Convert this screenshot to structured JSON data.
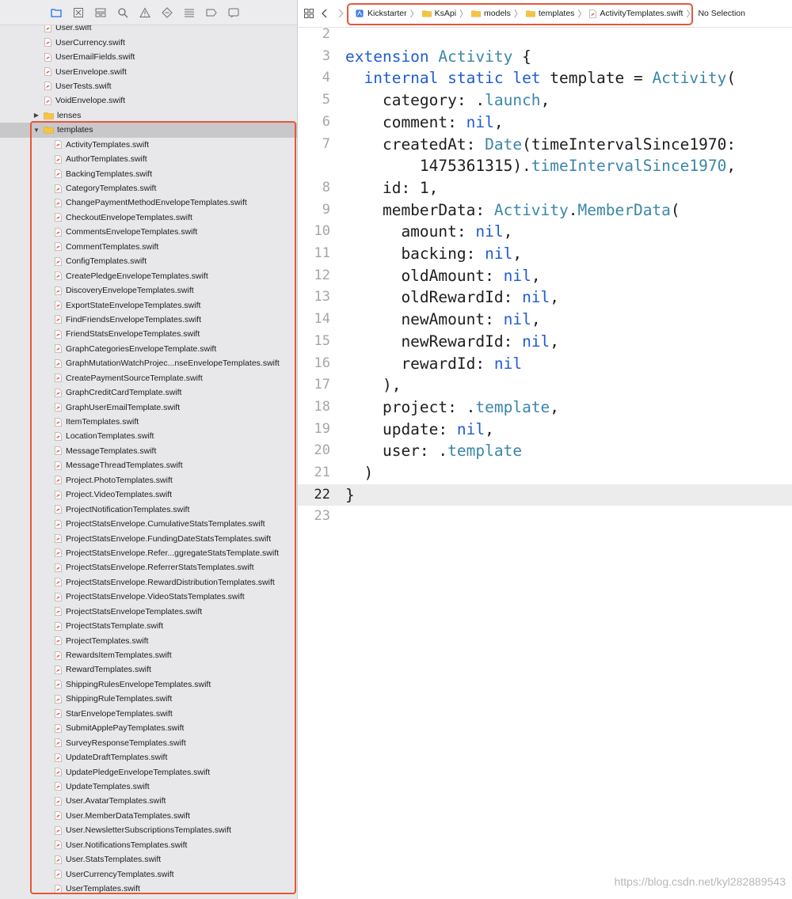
{
  "sidebar": {
    "navigator_icons": [
      "folder-icon",
      "source-control-icon",
      "symbol-icon",
      "find-icon",
      "issue-icon",
      "test-icon",
      "debug-icon",
      "breakpoint-icon",
      "report-icon"
    ],
    "files_before": [
      "User.swift",
      "UserCurrency.swift",
      "UserEmailFields.swift",
      "UserEnvelope.swift",
      "UserTests.swift",
      "VoidEnvelope.swift"
    ],
    "lenses_folder": "lenses",
    "templates_folder": "templates",
    "template_files": [
      "ActivityTemplates.swift",
      "AuthorTemplates.swift",
      "BackingTemplates.swift",
      "CategoryTemplates.swift",
      "ChangePaymentMethodEnvelopeTemplates.swift",
      "CheckoutEnvelopeTemplates.swift",
      "CommentsEnvelopeTemplates.swift",
      "CommentTemplates.swift",
      "ConfigTemplates.swift",
      "CreatePledgeEnvelopeTemplates.swift",
      "DiscoveryEnvelopeTemplates.swift",
      "ExportStateEnvelopeTemplates.swift",
      "FindFriendsEnvelopeTemplates.swift",
      "FriendStatsEnvelopeTemplates.swift",
      "GraphCategoriesEnvelopeTemplate.swift",
      "GraphMutationWatchProjec...nseEnvelopeTemplates.swift",
      "CreatePaymentSourceTemplate.swift",
      "GraphCreditCardTemplate.swift",
      "GraphUserEmailTemplate.swift",
      "ItemTemplates.swift",
      "LocationTemplates.swift",
      "MessageTemplates.swift",
      "MessageThreadTemplates.swift",
      "Project.PhotoTemplates.swift",
      "Project.VideoTemplates.swift",
      "ProjectNotificationTemplates.swift",
      "ProjectStatsEnvelope.CumulativeStatsTemplates.swift",
      "ProjectStatsEnvelope.FundingDateStatsTemplates.swift",
      "ProjectStatsEnvelope.Refer...ggregateStatsTemplate.swift",
      "ProjectStatsEnvelope.ReferrerStatsTemplates.swift",
      "ProjectStatsEnvelope.RewardDistributionTemplates.swift",
      "ProjectStatsEnvelope.VideoStatsTemplates.swift",
      "ProjectStatsEnvelopeTemplates.swift",
      "ProjectStatsTemplate.swift",
      "ProjectTemplates.swift",
      "RewardsItemTemplates.swift",
      "RewardTemplates.swift",
      "ShippingRulesEnvelopeTemplates.swift",
      "ShippingRuleTemplates.swift",
      "StarEnvelopeTemplates.swift",
      "SubmitApplePayTemplates.swift",
      "SurveyResponseTemplates.swift",
      "UpdateDraftTemplates.swift",
      "UpdatePledgeEnvelopeTemplates.swift",
      "UpdateTemplates.swift",
      "User.AvatarTemplates.swift",
      "User.MemberDataTemplates.swift",
      "User.NewsletterSubscriptionsTemplates.swift",
      "User.NotificationsTemplates.swift",
      "User.StatsTemplates.swift",
      "UserCurrencyTemplates.swift",
      "UserTemplates.swift"
    ]
  },
  "jump_bar": {
    "crumbs": [
      "Kickstarter",
      "KsApi",
      "models",
      "templates",
      "ActivityTemplates.swift"
    ],
    "selection": "No Selection"
  },
  "editor": {
    "current_line": "22",
    "lines": [
      {
        "n": "2",
        "tokens": []
      },
      {
        "n": "3",
        "tokens": [
          [
            "kw",
            "extension"
          ],
          [
            "p",
            " "
          ],
          [
            "ty",
            "Activity"
          ],
          [
            "p",
            " {"
          ]
        ]
      },
      {
        "n": "4",
        "tokens": [
          [
            "p",
            "  "
          ],
          [
            "kw",
            "internal static let"
          ],
          [
            "p",
            " template = "
          ],
          [
            "ty",
            "Activity"
          ],
          [
            "p",
            "("
          ]
        ]
      },
      {
        "n": "5",
        "tokens": [
          [
            "p",
            "    category: ."
          ],
          [
            "mem",
            "launch"
          ],
          [
            "p",
            ","
          ]
        ]
      },
      {
        "n": "6",
        "tokens": [
          [
            "p",
            "    comment: "
          ],
          [
            "nil",
            "nil"
          ],
          [
            "p",
            ","
          ]
        ]
      },
      {
        "n": "7",
        "tokens": [
          [
            "p",
            "    createdAt: "
          ],
          [
            "ty",
            "Date"
          ],
          [
            "p",
            "(timeIntervalSince1970:"
          ]
        ]
      },
      {
        "n": "",
        "tokens": [
          [
            "p",
            "        1475361315)."
          ],
          [
            "mem",
            "timeIntervalSince1970"
          ],
          [
            "p",
            ","
          ]
        ]
      },
      {
        "n": "8",
        "tokens": [
          [
            "p",
            "    id: 1,"
          ]
        ]
      },
      {
        "n": "9",
        "tokens": [
          [
            "p",
            "    memberData: "
          ],
          [
            "ty",
            "Activity"
          ],
          [
            "p",
            "."
          ],
          [
            "ty",
            "MemberData"
          ],
          [
            "p",
            "("
          ]
        ]
      },
      {
        "n": "10",
        "tokens": [
          [
            "p",
            "      amount: "
          ],
          [
            "nil",
            "nil"
          ],
          [
            "p",
            ","
          ]
        ]
      },
      {
        "n": "11",
        "tokens": [
          [
            "p",
            "      backing: "
          ],
          [
            "nil",
            "nil"
          ],
          [
            "p",
            ","
          ]
        ]
      },
      {
        "n": "12",
        "tokens": [
          [
            "p",
            "      oldAmount: "
          ],
          [
            "nil",
            "nil"
          ],
          [
            "p",
            ","
          ]
        ]
      },
      {
        "n": "13",
        "tokens": [
          [
            "p",
            "      oldRewardId: "
          ],
          [
            "nil",
            "nil"
          ],
          [
            "p",
            ","
          ]
        ]
      },
      {
        "n": "14",
        "tokens": [
          [
            "p",
            "      newAmount: "
          ],
          [
            "nil",
            "nil"
          ],
          [
            "p",
            ","
          ]
        ]
      },
      {
        "n": "15",
        "tokens": [
          [
            "p",
            "      newRewardId: "
          ],
          [
            "nil",
            "nil"
          ],
          [
            "p",
            ","
          ]
        ]
      },
      {
        "n": "16",
        "tokens": [
          [
            "p",
            "      rewardId: "
          ],
          [
            "nil",
            "nil"
          ]
        ]
      },
      {
        "n": "17",
        "tokens": [
          [
            "p",
            "    ),"
          ]
        ]
      },
      {
        "n": "18",
        "tokens": [
          [
            "p",
            "    project: ."
          ],
          [
            "mem",
            "template"
          ],
          [
            "p",
            ","
          ]
        ]
      },
      {
        "n": "19",
        "tokens": [
          [
            "p",
            "    update: "
          ],
          [
            "nil",
            "nil"
          ],
          [
            "p",
            ","
          ]
        ]
      },
      {
        "n": "20",
        "tokens": [
          [
            "p",
            "    user: ."
          ],
          [
            "mem",
            "template"
          ]
        ]
      },
      {
        "n": "21",
        "tokens": [
          [
            "p",
            "  )"
          ]
        ]
      },
      {
        "n": "22",
        "tokens": [
          [
            "p",
            "}"
          ]
        ]
      },
      {
        "n": "23",
        "tokens": []
      }
    ]
  },
  "watermark": "https://blog.csdn.net/kyl282889543",
  "colors": {
    "highlight_box": "#e8563a",
    "keyword": "#1f5dd1",
    "type": "#3a86a8",
    "swift_icon": "#f05138",
    "folder": "#f5c542"
  }
}
